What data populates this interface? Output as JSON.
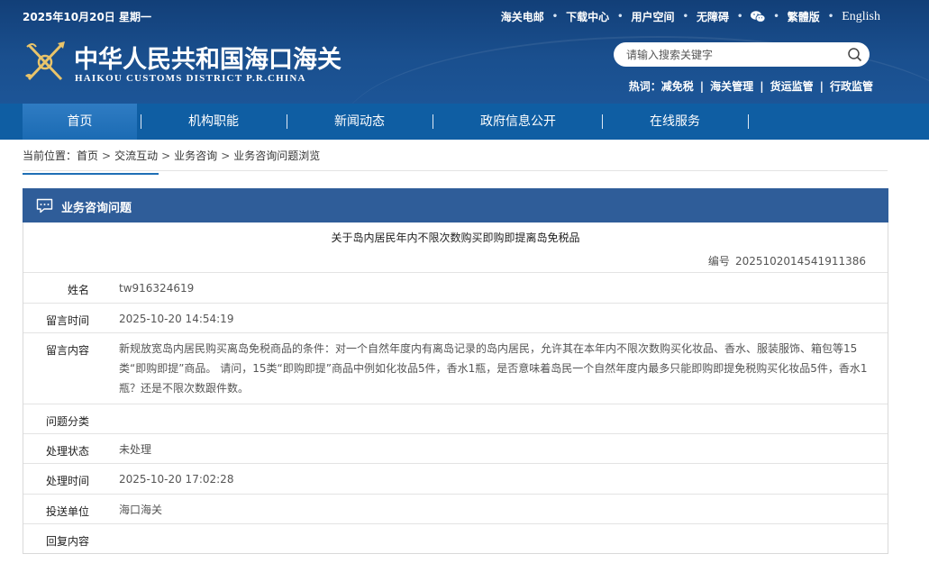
{
  "header": {
    "date": "2025年10月20日 星期一",
    "top_links": [
      "海关电邮",
      "下载中心",
      "用户空间",
      "无障碍",
      "繁體版",
      "English"
    ],
    "title_cn": "中华人民共和国海口海关",
    "title_en": "HAIKOU CUSTOMS DISTRICT P.R.CHINA",
    "search_placeholder": "请输入搜索关键字",
    "hot_label": "热词：",
    "hot_words": [
      "减免税",
      "海关管理",
      "货运监管",
      "行政监管"
    ]
  },
  "nav": {
    "items": [
      "首页",
      "机构职能",
      "新闻动态",
      "政府信息公开",
      "在线服务"
    ],
    "active_index": 0
  },
  "breadcrumb": {
    "label": "当前位置：",
    "items": [
      "首页",
      "交流互动",
      "业务咨询"
    ],
    "current": "业务咨询问题浏览"
  },
  "panel": {
    "title": "业务咨询问题",
    "question_title": "关于岛内居民年内不限次数购买即购即提离岛免税品",
    "number_label": "编号",
    "number": "20251020145419113​86",
    "rows": [
      {
        "label": "姓名",
        "value": "tw916324619"
      },
      {
        "label": "留言时间",
        "value": "2025-10-20 14:54:19"
      },
      {
        "label": "留言内容",
        "value": "新规放宽岛内居民购买离岛免税商品的条件：对一个自然年度内有离岛记录的岛内居民，允许其在本年内不限次数购买化妆品、香水、服装服饰、箱包等15类“即购即提”商品。 请问，15类“即购即提”商品中例如化妆品5件，香水1瓶，是否意味着岛民一个自然年度内最多只能即购即提免税购买化妆品5件，香水1瓶？还是不限次数跟件数。"
      },
      {
        "label": "问题分类",
        "value": ""
      },
      {
        "label": "处理状态",
        "value": "未处理"
      },
      {
        "label": "处理时间",
        "value": "2025-10-20 17:02:28"
      },
      {
        "label": "投送单位",
        "value": "海口海关"
      },
      {
        "label": "回复内容",
        "value": ""
      }
    ]
  },
  "colors": {
    "header_bg": "#1a4f8e",
    "nav_bg": "#0f5ea3",
    "panel_head_bg": "#2f5d99",
    "accent_line": "#1f6fb5"
  },
  "icons": [
    "customs-emblem-icon",
    "wechat-icon",
    "search-icon",
    "chat-bubble-icon"
  ]
}
